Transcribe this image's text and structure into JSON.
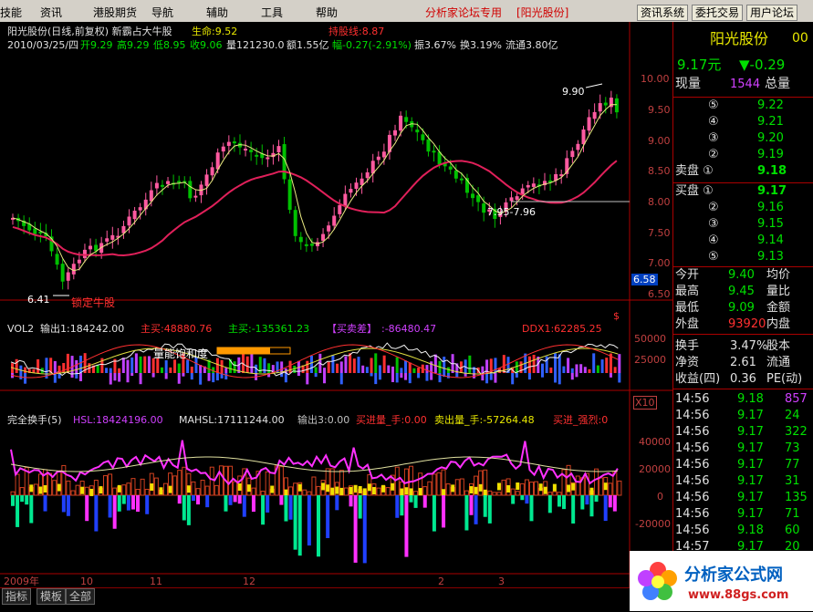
{
  "menu": {
    "items": [
      "技能",
      "资讯",
      "港股期货",
      "导航",
      "辅助",
      "工具",
      "帮助"
    ],
    "watermark": "分析家论坛专用",
    "stock_tag": "[阳光股份]",
    "buttons": [
      "资讯系统",
      "委托交易",
      "用户论坛"
    ]
  },
  "header": {
    "line1_name": "阳光股份(日线,前复权) 新霸占大牛股",
    "life_label": "生命:9.52",
    "hold_label": "持股线:8.87",
    "line2_date": "2010/03/25/四",
    "open_label": "开9.29",
    "high_label": "高9.29",
    "low_label": "低8.95",
    "close_label": "收9.06",
    "vol_label": "量121230.0",
    "amount_label": "额1.55亿",
    "change_label": "幅-0.27(-2.91%)",
    "amp_label": "振3.67%",
    "turn_label": "换3.19%",
    "float_label": "流通3.80亿"
  },
  "price_axis": [
    "10.00",
    "9.50",
    "9.00",
    "8.50",
    "8.00",
    "7.50",
    "7.00",
    "6.50"
  ],
  "price_tag": "6.58",
  "price_marker": "$",
  "annotations": {
    "high": "9.90",
    "low": "6.41",
    "low_text": "锁定牛股",
    "range": "7.95-7.96",
    "volume_text": "量能饱和度"
  },
  "vol_panel": {
    "name": "VOL2",
    "output": "输出1:184242.00",
    "main_buy": "主买:48880.76",
    "main_sell": "主买:-135361.23",
    "diff_label": "【买卖差】",
    "diff_value": ":-86480.47",
    "ddx": "DDX1:62285.25",
    "axis": [
      "50000",
      "25000"
    ],
    "x_tag": "X10"
  },
  "turn_panel": {
    "name": "完全换手(5)",
    "hsl": "HSL:18424196.00",
    "mahsl": "MAHSL:17111244.00",
    "out": "输出3:0.00",
    "buy": "买进量_手:0.00",
    "sell": "卖出量_手:-57264.48",
    "strong": "买进_强烈:0",
    "axis": [
      "40000",
      "20000",
      "0",
      "-20000"
    ]
  },
  "x_axis": [
    "2009年",
    "10",
    "11",
    "12",
    "2",
    "3"
  ],
  "bottom_tabs": [
    "指标",
    "模板",
    "全部"
  ],
  "quote": {
    "name": "阳光股份",
    "code": "00",
    "price": "9.17元",
    "change": "▼-0.29",
    "now_vol_label": "现量",
    "now_vol": "1544",
    "total_label": "总量",
    "asks": [
      {
        "label": "⑤",
        "price": "9.22"
      },
      {
        "label": "④",
        "price": "9.21"
      },
      {
        "label": "③",
        "price": "9.20"
      },
      {
        "label": "②",
        "price": "9.19"
      },
      {
        "label": "卖盘 ①",
        "price": "9.18"
      }
    ],
    "bids": [
      {
        "label": "买盘 ①",
        "price": "9.17"
      },
      {
        "label": "②",
        "price": "9.16"
      },
      {
        "label": "③",
        "price": "9.15"
      },
      {
        "label": "④",
        "price": "9.14"
      },
      {
        "label": "⑤",
        "price": "9.13"
      }
    ],
    "stats": [
      {
        "l1": "今开",
        "v1": "9.40",
        "l2": "均价"
      },
      {
        "l1": "最高",
        "v1": "9.45",
        "l2": "量比"
      },
      {
        "l1": "最低",
        "v1": "9.09",
        "l2": "金额"
      },
      {
        "l1": "外盘",
        "v1": "93920",
        "l2": "内盘"
      }
    ],
    "stats2": [
      {
        "l1": "换手",
        "v1": "3.47%",
        "l2": "股本"
      },
      {
        "l1": "净资",
        "v1": "2.61",
        "l2": "流通"
      },
      {
        "l1": "收益(四)",
        "v1": "0.36",
        "l2": "PE(动)"
      }
    ],
    "ticks": [
      {
        "time": "14:56",
        "price": "9.18",
        "vol": "857"
      },
      {
        "time": "14:56",
        "price": "9.17",
        "vol": "24"
      },
      {
        "time": "14:56",
        "price": "9.17",
        "vol": "322"
      },
      {
        "time": "14:56",
        "price": "9.17",
        "vol": "73"
      },
      {
        "time": "14:56",
        "price": "9.17",
        "vol": "77"
      },
      {
        "time": "14:56",
        "price": "9.17",
        "vol": "31"
      },
      {
        "time": "14:56",
        "price": "9.17",
        "vol": "135"
      },
      {
        "time": "14:56",
        "price": "9.17",
        "vol": "71"
      },
      {
        "time": "14:56",
        "price": "9.18",
        "vol": "60"
      },
      {
        "time": "14:57",
        "price": "9.17",
        "vol": "20"
      }
    ]
  },
  "logo": {
    "title": "分析家公式网",
    "url": "www.88gs.com"
  },
  "colors": {
    "up": "#ff5aa0",
    "down": "#00c000",
    "ma": "#e0205a",
    "thin": "#e8e880"
  }
}
